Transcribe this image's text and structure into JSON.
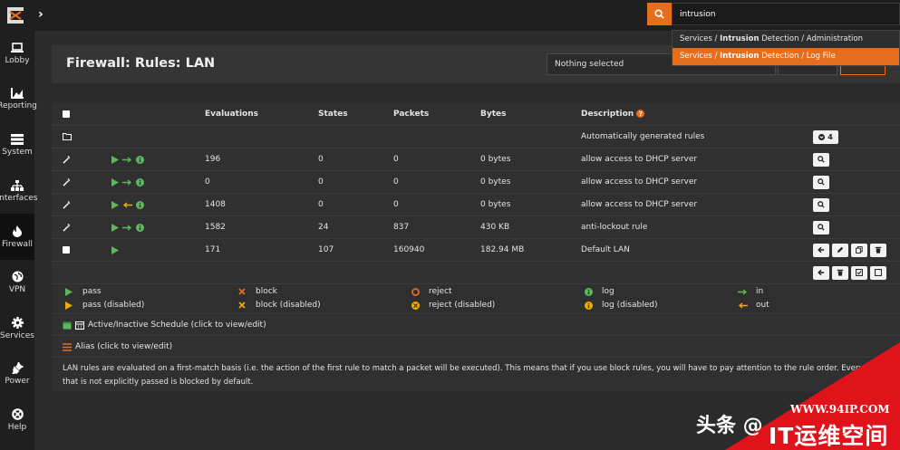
{
  "topbar": {
    "search_value": "intrusion",
    "suggestions": [
      {
        "prefix": "Services / ",
        "match": "Intrusion",
        "suffix": " Detection / Administration"
      },
      {
        "prefix": "Services / ",
        "match": "Intrusion",
        "suffix": " Detection / Log File"
      }
    ]
  },
  "sidebar": {
    "items": [
      {
        "label": "Lobby",
        "icon": "laptop-icon"
      },
      {
        "label": "Reporting",
        "icon": "area-chart-icon"
      },
      {
        "label": "System",
        "icon": "server-icon"
      },
      {
        "label": "Interfaces",
        "icon": "sitemap-icon"
      },
      {
        "label": "Firewall",
        "icon": "fire-icon"
      },
      {
        "label": "VPN",
        "icon": "globe-icon"
      },
      {
        "label": "Services",
        "icon": "cog-icon"
      },
      {
        "label": "Power",
        "icon": "plug-icon"
      },
      {
        "label": "Help",
        "icon": "lifebuoy-icon"
      }
    ]
  },
  "header": {
    "title": "Firewall: Rules: LAN",
    "select_value": "Nothing selected"
  },
  "table": {
    "columns": {
      "evaluations": "Evaluations",
      "states": "States",
      "packets": "Packets",
      "bytes": "Bytes",
      "description": "Description"
    },
    "auto_row": {
      "description": "Automatically generated rules",
      "count": "4"
    },
    "rows": [
      {
        "evaluations": "196",
        "states": "0",
        "packets": "0",
        "bytes": "0 bytes",
        "description": "allow access to DHCP server",
        "dir": "in"
      },
      {
        "evaluations": "0",
        "states": "0",
        "packets": "0",
        "bytes": "0 bytes",
        "description": "allow access to DHCP server",
        "dir": "in"
      },
      {
        "evaluations": "1408",
        "states": "0",
        "packets": "0",
        "bytes": "0 bytes",
        "description": "allow access to DHCP server",
        "dir": "out"
      },
      {
        "evaluations": "1582",
        "states": "24",
        "packets": "837",
        "bytes": "430 KB",
        "description": "anti-lockout rule",
        "dir": "in"
      }
    ],
    "default_row": {
      "evaluations": "171",
      "states": "107",
      "packets": "160940",
      "bytes": "182.94 MB",
      "description": "Default LAN"
    }
  },
  "legend": {
    "pass": "pass",
    "pass_disabled": "pass (disabled)",
    "block": "block",
    "block_disabled": "block (disabled)",
    "reject": "reject",
    "reject_disabled": "reject (disabled)",
    "log": "log",
    "log_disabled": "log (disabled)",
    "in": "in",
    "out": "out"
  },
  "schedule_text": "Active/Inactive Schedule (click to view/edit)",
  "alias_text": "Alias (click to view/edit)",
  "note_text": "LAN rules are evaluated on a first-match basis (i.e. the action of the first rule to match a packet will be executed). This means that if you use block rules, you will have to pay attention to the rule order. Everything that is not explicitly passed is blocked by default.",
  "watermark": {
    "url": "WWW.94IP.COM",
    "brand": "IT运维空间",
    "source": "头条 @"
  },
  "colors": {
    "accent": "#e46e1d",
    "pass": "#5cb85c",
    "warn": "#f0ad00",
    "block": "#e46e1d",
    "watermark": "#e0131b"
  }
}
